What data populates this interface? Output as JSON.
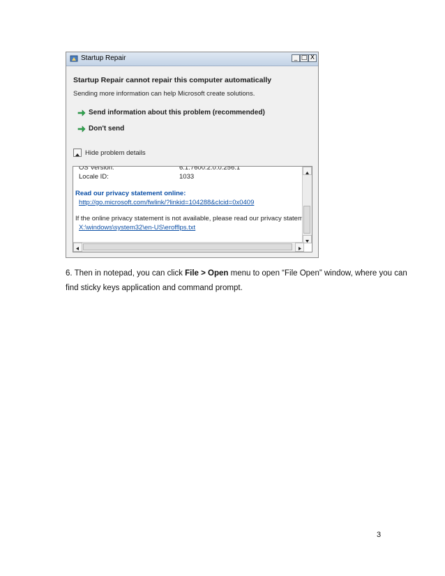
{
  "window": {
    "title": "Startup Repair",
    "controls": {
      "minimize": "_",
      "maximize": "□",
      "close": "X"
    }
  },
  "dialog": {
    "heading": "Startup Repair cannot repair this computer automatically",
    "subtext": "Sending more information can help Microsoft create solutions.",
    "options": [
      {
        "label": "Send information about this problem (recommended)",
        "icon": "green-arrow-icon"
      },
      {
        "label": "Don't send",
        "icon": "green-arrow-icon"
      }
    ],
    "toggle_label": "Hide problem details"
  },
  "details": {
    "os_version_label": "OS Version:",
    "os_version_value": "6.1.7600.2.0.0.256.1",
    "locale_label": "Locale ID:",
    "locale_value": "1033",
    "privacy_heading": "Read our privacy statement online:",
    "privacy_link": "http://go.microsoft.com/fwlink/?linkid=104288&clcid=0x0409",
    "offline_text": "If the online privacy statement is not available, please read our privacy statement",
    "offline_path": "X:\\windows\\system32\\en-US\\erofflps.txt"
  },
  "document": {
    "line1_pre": "6. Then in notepad, you can click ",
    "line1_bold": "File > Open",
    "line1_post": " menu to open “File Open” window, where you can",
    "line2": "find sticky keys application and command prompt.",
    "page_number": "3"
  }
}
